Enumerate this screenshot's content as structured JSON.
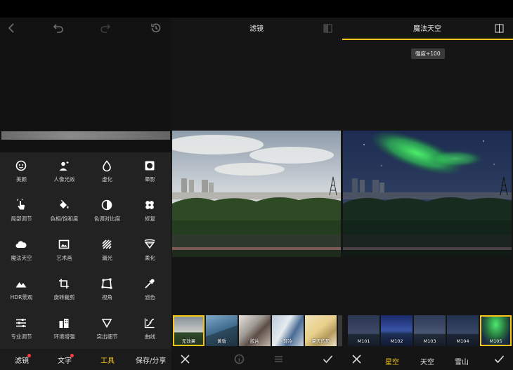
{
  "left_panel": {
    "tools": [
      {
        "label": "美颜"
      },
      {
        "label": "人像光效"
      },
      {
        "label": "虚化"
      },
      {
        "label": "晕影"
      },
      {
        "label": "局部调节"
      },
      {
        "label": "色相/饱和度"
      },
      {
        "label": "色调对比度"
      },
      {
        "label": "修复"
      },
      {
        "label": "魔法天空"
      },
      {
        "label": "艺术画"
      },
      {
        "label": "漏光"
      },
      {
        "label": "柔化"
      },
      {
        "label": "HDR景观"
      },
      {
        "label": "旋转裁剪"
      },
      {
        "label": "视角"
      },
      {
        "label": "滤色"
      },
      {
        "label": "专业调节"
      },
      {
        "label": "环境增强"
      },
      {
        "label": "突出细节"
      },
      {
        "label": "曲线"
      }
    ],
    "tabs": {
      "filter": "滤镜",
      "text": "文字",
      "tools": "工具",
      "save": "保存/分享"
    }
  },
  "filter_pane": {
    "title": "滤镜",
    "thumbnails": [
      {
        "label": "无效果"
      },
      {
        "label": "黄昏"
      },
      {
        "label": "胶片"
      },
      {
        "label": "轻冷"
      },
      {
        "label": "夏天的风"
      }
    ]
  },
  "sky_pane": {
    "title": "魔法天空",
    "strength_tooltip": "强度+100",
    "thumbnails": [
      {
        "label": "M101"
      },
      {
        "label": "M102"
      },
      {
        "label": "M103"
      },
      {
        "label": "M104"
      },
      {
        "label": "M105"
      }
    ],
    "tabs": {
      "starry": "星空",
      "sky": "天空",
      "snow": "雪山"
    }
  },
  "colors": {
    "accent": "#f5c518",
    "badge": "#ff3b3b"
  }
}
